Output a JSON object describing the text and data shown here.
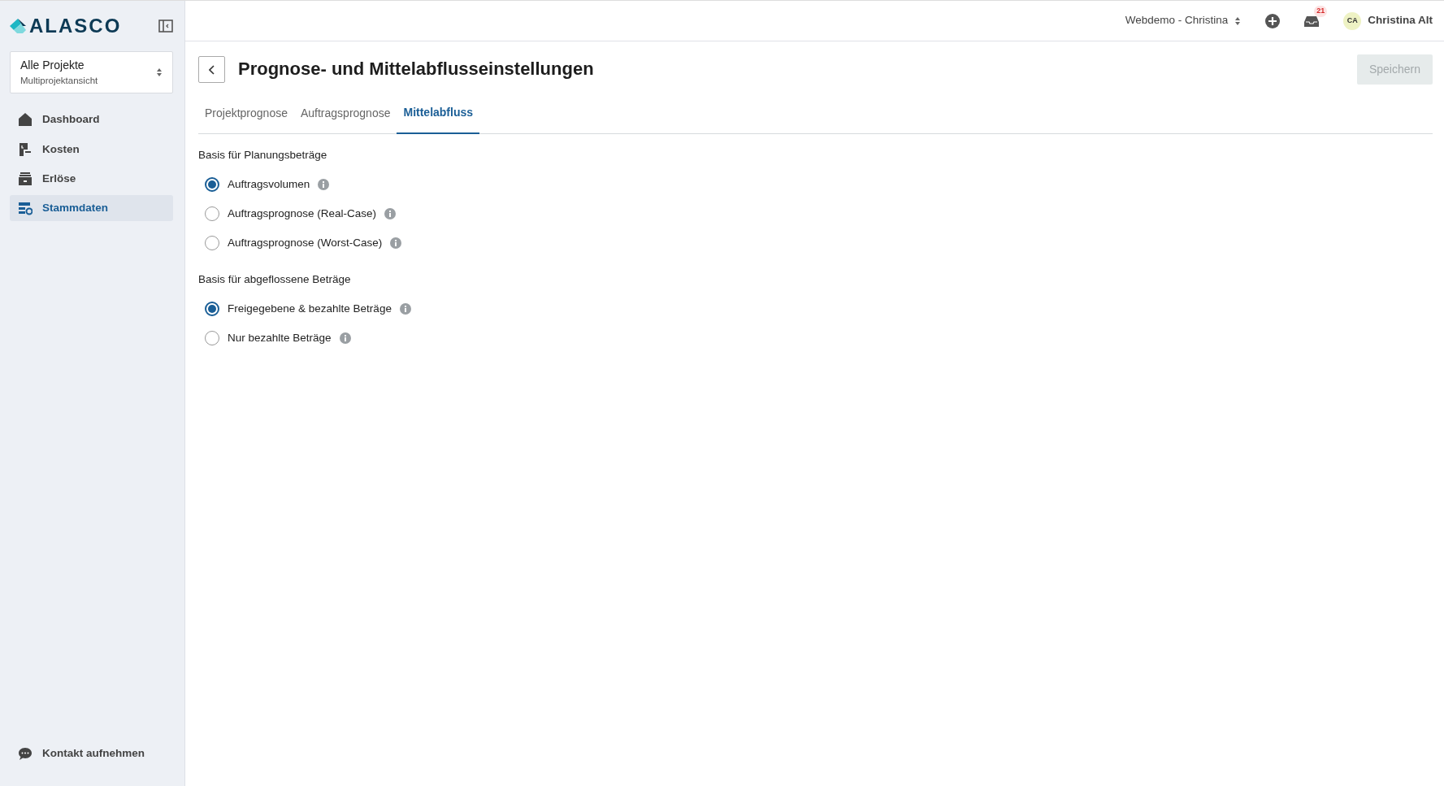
{
  "sidebar": {
    "logo": "ALASCO",
    "project_selector": {
      "title": "Alle Projekte",
      "subtitle": "Multiprojektansicht"
    },
    "items": [
      {
        "label": "Dashboard",
        "selected": false
      },
      {
        "label": "Kosten",
        "selected": false
      },
      {
        "label": "Erlöse",
        "selected": false
      },
      {
        "label": "Stammdaten",
        "selected": true
      }
    ],
    "footer_link": "Kontakt aufnehmen"
  },
  "header": {
    "workspace": "Webdemo - Christina",
    "notification_count": "21",
    "user": {
      "initials": "CA",
      "name": "Christina Alt"
    }
  },
  "page": {
    "title": "Prognose- und Mittelabflusseinstellungen",
    "save_button": {
      "label": "Speichern",
      "disabled": true
    },
    "tabs": [
      {
        "label": "Projektprognose",
        "selected": false
      },
      {
        "label": "Auftragsprognose",
        "selected": false
      },
      {
        "label": "Mittelabfluss",
        "selected": true
      }
    ],
    "sections": [
      {
        "title": "Basis für Planungsbeträge",
        "options": [
          {
            "label": "Auftragsvolumen",
            "selected": true
          },
          {
            "label": "Auftragsprognose (Real-Case)",
            "selected": false
          },
          {
            "label": "Auftragsprognose (Worst-Case)",
            "selected": false
          }
        ]
      },
      {
        "title": "Basis für abgeflossene Beträge",
        "options": [
          {
            "label": "Freigegebene & bezahlte Beträge",
            "selected": true
          },
          {
            "label": "Nur bezahlte Beträge",
            "selected": false
          }
        ]
      }
    ]
  }
}
